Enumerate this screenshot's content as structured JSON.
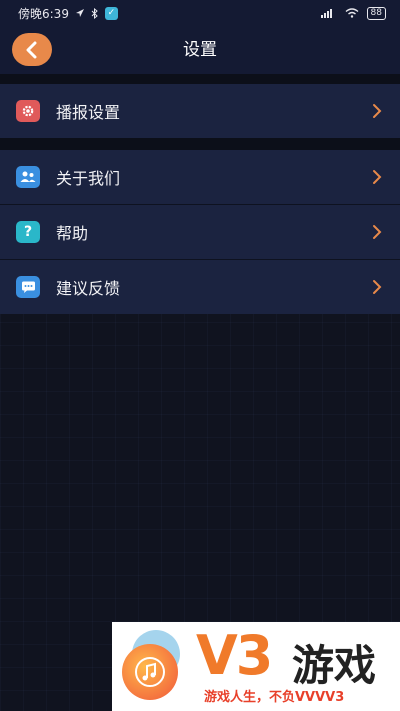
{
  "status_bar": {
    "time": "傍晚6:39",
    "battery": "88"
  },
  "header": {
    "title": "设置",
    "back_icon": "chevron-left-icon"
  },
  "menu_groups": [
    {
      "items": [
        {
          "label": "播报设置",
          "icon": "gear-icon",
          "icon_color": "#e05a5a"
        }
      ]
    },
    {
      "items": [
        {
          "label": "关于我们",
          "icon": "people-icon",
          "icon_color": "#3a8fe0"
        },
        {
          "label": "帮助",
          "icon": "question-icon",
          "icon_color": "#2ab7c9"
        },
        {
          "label": "建议反馈",
          "icon": "chat-icon",
          "icon_color": "#3a8fe0"
        }
      ]
    }
  ],
  "colors": {
    "accent": "#e8894a",
    "chevron": "#e8894a",
    "row_bg": "#1b2340",
    "page_bg": "#10131f"
  },
  "ad": {
    "brand": "V3",
    "name": "游戏",
    "slogan": "游戏人生，不负VVVV3"
  }
}
